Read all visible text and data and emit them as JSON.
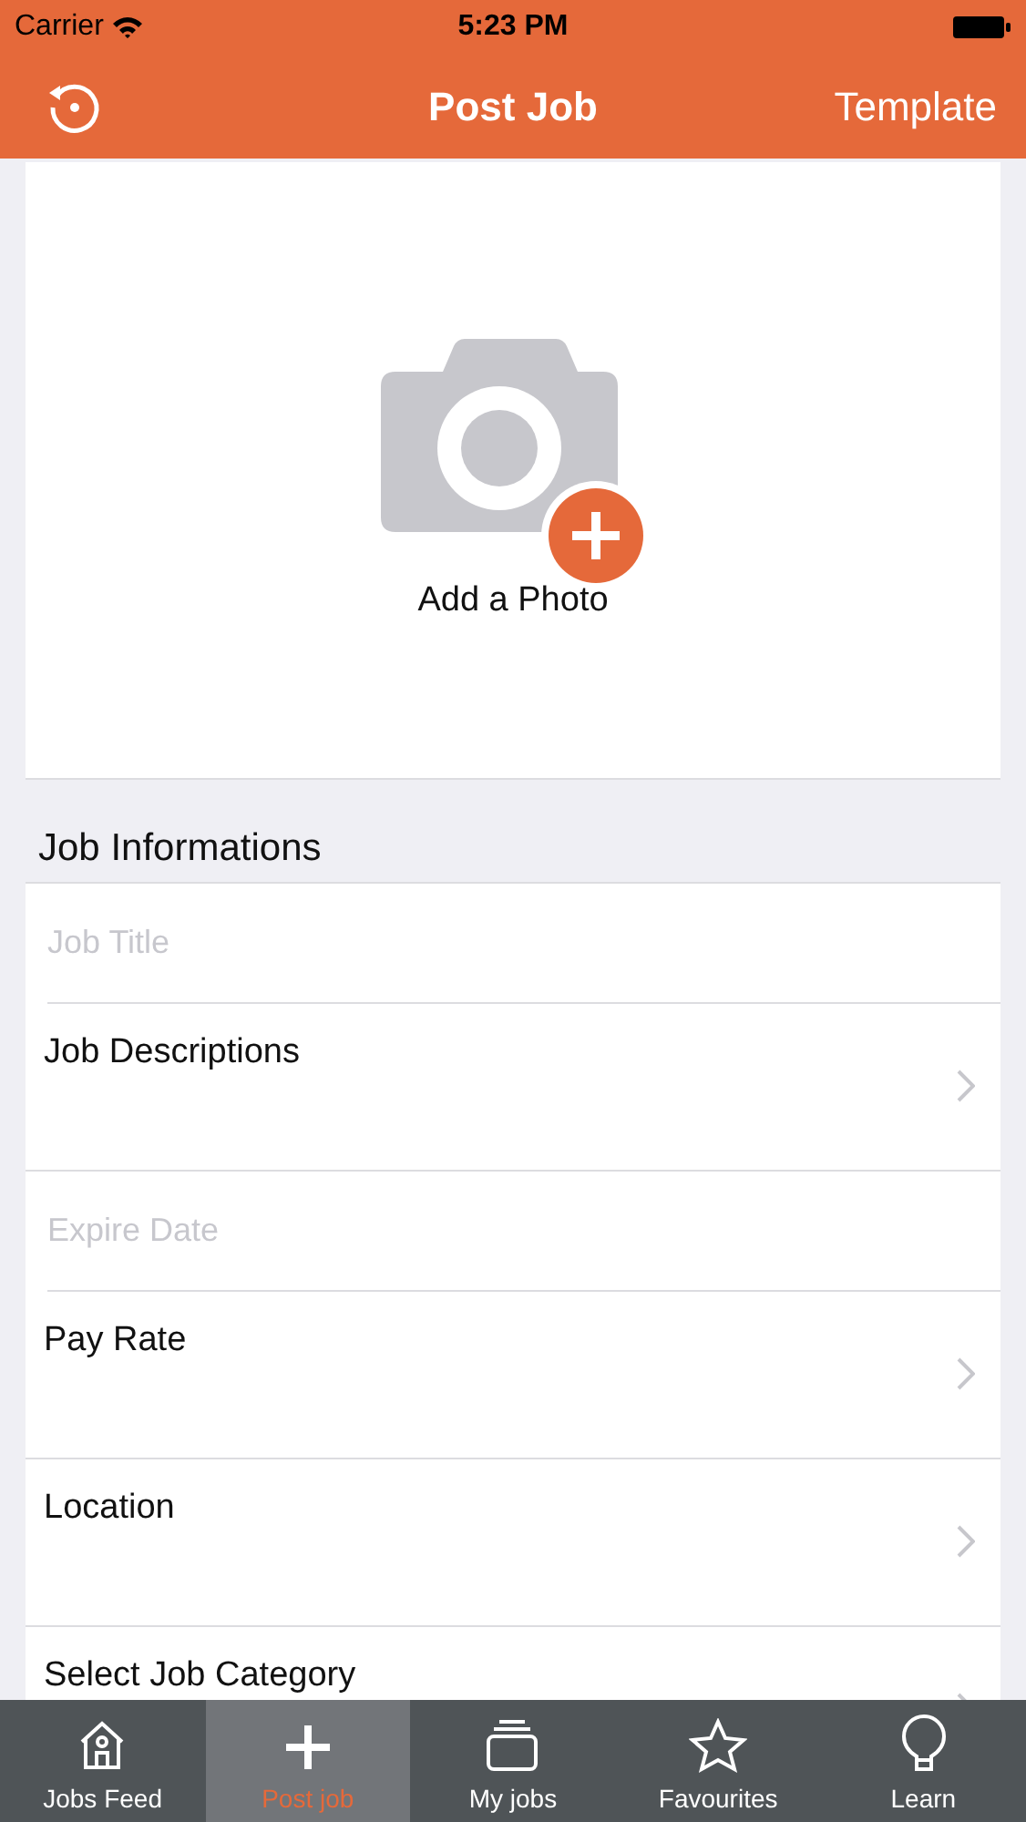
{
  "status_bar": {
    "carrier": "Carrier",
    "time": "5:23 PM"
  },
  "nav_bar": {
    "title": "Post Job",
    "right_button": "Template"
  },
  "photo": {
    "label": "Add a Photo"
  },
  "section": {
    "title": "Job Informations"
  },
  "fields": [
    {
      "kind": "input",
      "placeholder": "Job Title"
    },
    {
      "kind": "link",
      "label": "Job Descriptions"
    },
    {
      "kind": "input",
      "placeholder": "Expire Date"
    },
    {
      "kind": "link",
      "label": "Pay Rate"
    },
    {
      "kind": "link",
      "label": "Location"
    },
    {
      "kind": "link",
      "label": "Select Job Category"
    }
  ],
  "tabs": [
    {
      "kind": "house",
      "label": "Jobs Feed",
      "selected": false
    },
    {
      "kind": "plus",
      "label": "Post job",
      "selected": true
    },
    {
      "kind": "stack",
      "label": "My jobs",
      "selected": false
    },
    {
      "kind": "star",
      "label": "Favourites",
      "selected": false
    },
    {
      "kind": "bulb",
      "label": "Learn",
      "selected": false
    }
  ]
}
